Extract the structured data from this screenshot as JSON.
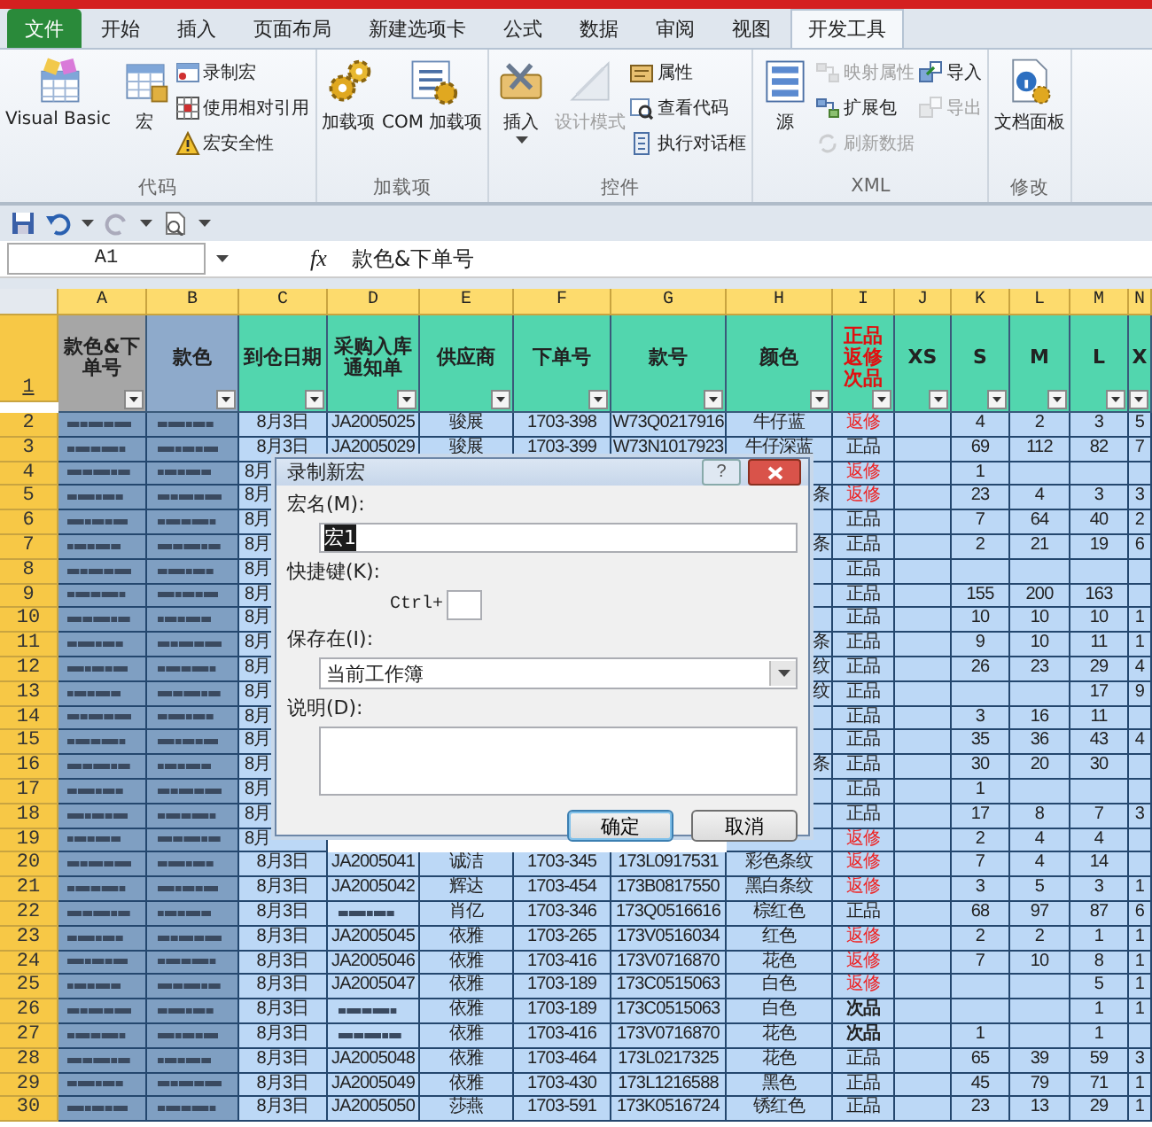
{
  "ribbon": {
    "tabs": [
      {
        "label": "文件",
        "kind": "file",
        "selected": false
      },
      {
        "label": "开始",
        "kind": "tab",
        "selected": false
      },
      {
        "label": "插入",
        "kind": "tab",
        "selected": false
      },
      {
        "label": "页面布局",
        "kind": "tab",
        "selected": false
      },
      {
        "label": "新建选项卡",
        "kind": "tab",
        "selected": false
      },
      {
        "label": "公式",
        "kind": "tab",
        "selected": false
      },
      {
        "label": "数据",
        "kind": "tab",
        "selected": false
      },
      {
        "label": "审阅",
        "kind": "tab",
        "selected": false
      },
      {
        "label": "视图",
        "kind": "tab",
        "selected": false
      },
      {
        "label": "开发工具",
        "kind": "tab",
        "selected": true
      }
    ],
    "groups": [
      {
        "title": "代码",
        "columns": [
          {
            "kind": "large",
            "label": "Visual Basic",
            "disabled": false
          },
          {
            "kind": "large",
            "label": "宏",
            "disabled": false
          },
          {
            "kind": "stack",
            "items": [
              {
                "label": "录制宏",
                "disabled": false
              },
              {
                "label": "使用相对引用",
                "disabled": false
              },
              {
                "label": "宏安全性",
                "disabled": false
              }
            ]
          }
        ]
      },
      {
        "title": "加载项",
        "columns": [
          {
            "kind": "large",
            "label": "加载项",
            "disabled": false
          },
          {
            "kind": "large",
            "label": "COM 加载项",
            "disabled": false
          }
        ]
      },
      {
        "title": "控件",
        "columns": [
          {
            "kind": "large",
            "label": "插入",
            "disabled": false,
            "dropdown": true
          },
          {
            "kind": "large",
            "label": "设计模式",
            "disabled": true
          },
          {
            "kind": "stack",
            "items": [
              {
                "label": "属性",
                "disabled": false
              },
              {
                "label": "查看代码",
                "disabled": false
              },
              {
                "label": "执行对话框",
                "disabled": false
              }
            ]
          }
        ]
      },
      {
        "title": "XML",
        "columns": [
          {
            "kind": "large",
            "label": "源",
            "disabled": false
          },
          {
            "kind": "stack",
            "items": [
              {
                "label": "映射属性",
                "disabled": true
              },
              {
                "label": "扩展包",
                "disabled": false
              },
              {
                "label": "刷新数据",
                "disabled": true
              }
            ]
          },
          {
            "kind": "stack",
            "items": [
              {
                "label": "导入",
                "disabled": false
              },
              {
                "label": "导出",
                "disabled": true
              }
            ]
          }
        ]
      },
      {
        "title": "修改",
        "columns": [
          {
            "kind": "large",
            "label": "文档面板",
            "disabled": false
          }
        ]
      }
    ]
  },
  "formula_bar": {
    "name_box": "A1",
    "function_label": "fx",
    "formula": "款色&下单号"
  },
  "sheet": {
    "column_letters": [
      "A",
      "B",
      "C",
      "D",
      "E",
      "F",
      "G",
      "H",
      "I",
      "J",
      "K",
      "L",
      "M",
      "N"
    ],
    "header_row": "1",
    "headers": [
      {
        "label": "款色&下单号",
        "color": "#a6a6a6",
        "alert": false
      },
      {
        "label": "款色",
        "color": "#8eaacb",
        "alert": false
      },
      {
        "label": "到仓日期",
        "color": "#52d6ae",
        "alert": false
      },
      {
        "label": "采购入库通知单",
        "color": "#52d6ae",
        "alert": false
      },
      {
        "label": "供应商",
        "color": "#52d6ae",
        "alert": false
      },
      {
        "label": "下单号",
        "color": "#52d6ae",
        "alert": false
      },
      {
        "label": "款号",
        "color": "#52d6ae",
        "alert": false
      },
      {
        "label": "颜色",
        "color": "#52d6ae",
        "alert": false
      },
      {
        "label": "正品返修次品",
        "color": "#52d6ae",
        "alert": true
      },
      {
        "label": "XS",
        "color": "#52d6ae",
        "alert": false
      },
      {
        "label": "S",
        "color": "#52d6ae",
        "alert": false
      },
      {
        "label": "M",
        "color": "#52d6ae",
        "alert": false
      },
      {
        "label": "L",
        "color": "#52d6ae",
        "alert": false
      },
      {
        "label": "X",
        "color": "#52d6ae",
        "alert": false
      }
    ],
    "rows": [
      {
        "num": "2",
        "c": "8月3日",
        "d": "JA2005025",
        "e": "骏展",
        "f": "1703-398",
        "g": "W73Q0217916",
        "h": "牛仔蓝",
        "i": {
          "text": "返修",
          "kind": "repair"
        },
        "k": "4",
        "l": "2",
        "m": "3",
        "n": "5"
      },
      {
        "num": "3",
        "c": "8月3日",
        "d": "JA2005029",
        "e": "骏展",
        "f": "1703-399",
        "g": "W73N1017923",
        "h": "牛仔深蓝",
        "i": {
          "text": "正品",
          "kind": "good"
        },
        "k": "69",
        "l": "112",
        "m": "82",
        "n": "7"
      },
      {
        "num": "4",
        "covered": true,
        "c": "8月",
        "i": {
          "text": "返修",
          "kind": "repair"
        },
        "k": "1"
      },
      {
        "num": "5",
        "covered": true,
        "c": "8月",
        "h": "条",
        "i": {
          "text": "返修",
          "kind": "repair"
        },
        "k": "23",
        "l": "4",
        "m": "3",
        "n": "3"
      },
      {
        "num": "6",
        "covered": true,
        "c": "8月",
        "i": {
          "text": "正品",
          "kind": "good"
        },
        "k": "7",
        "l": "64",
        "m": "40",
        "n": "2"
      },
      {
        "num": "7",
        "covered": true,
        "c": "8月",
        "h": "条",
        "i": {
          "text": "正品",
          "kind": "good"
        },
        "k": "2",
        "l": "21",
        "m": "19",
        "n": "6"
      },
      {
        "num": "8",
        "covered": true,
        "c": "8月",
        "i": {
          "text": "正品",
          "kind": "good"
        }
      },
      {
        "num": "9",
        "covered": true,
        "c": "8月",
        "i": {
          "text": "正品",
          "kind": "good"
        },
        "k": "155",
        "l": "200",
        "m": "163"
      },
      {
        "num": "10",
        "covered": true,
        "c": "8月",
        "i": {
          "text": "正品",
          "kind": "good"
        },
        "k": "10",
        "l": "10",
        "m": "10",
        "n": "1"
      },
      {
        "num": "11",
        "covered": true,
        "c": "8月",
        "h": "条",
        "i": {
          "text": "正品",
          "kind": "good"
        },
        "k": "9",
        "l": "10",
        "m": "11",
        "n": "1"
      },
      {
        "num": "12",
        "covered": true,
        "c": "8月",
        "h": "纹",
        "i": {
          "text": "正品",
          "kind": "good"
        },
        "k": "26",
        "l": "23",
        "m": "29",
        "n": "4"
      },
      {
        "num": "13",
        "covered": true,
        "c": "8月",
        "h": "纹",
        "i": {
          "text": "正品",
          "kind": "good"
        },
        "m": "17",
        "n": "9"
      },
      {
        "num": "14",
        "covered": true,
        "c": "8月",
        "i": {
          "text": "正品",
          "kind": "good"
        },
        "k": "3",
        "l": "16",
        "m": "11"
      },
      {
        "num": "15",
        "covered": true,
        "c": "8月",
        "i": {
          "text": "正品",
          "kind": "good"
        },
        "k": "35",
        "l": "36",
        "m": "43",
        "n": "4"
      },
      {
        "num": "16",
        "covered": true,
        "c": "8月",
        "h": "条",
        "i": {
          "text": "正品",
          "kind": "good"
        },
        "k": "30",
        "l": "20",
        "m": "30"
      },
      {
        "num": "17",
        "covered": true,
        "c": "8月",
        "i": {
          "text": "正品",
          "kind": "good"
        },
        "k": "1"
      },
      {
        "num": "18",
        "covered": true,
        "c": "8月",
        "i": {
          "text": "正品",
          "kind": "good"
        },
        "k": "17",
        "l": "8",
        "m": "7",
        "n": "3"
      },
      {
        "num": "19",
        "covered": true,
        "c": "8月",
        "i": {
          "text": "返修",
          "kind": "repair"
        },
        "k": "2",
        "l": "4",
        "m": "4"
      },
      {
        "num": "20",
        "c": "8月3日",
        "d": "JA2005041",
        "e": "诚洁",
        "f": "1703-345",
        "g": "173L0917531",
        "h": "彩色条纹",
        "i": {
          "text": "返修",
          "kind": "repair"
        },
        "k": "7",
        "l": "4",
        "m": "14"
      },
      {
        "num": "21",
        "c": "8月3日",
        "d": "JA2005042",
        "e": "辉达",
        "f": "1703-454",
        "g": "173B0817550",
        "h": "黑白条纹",
        "i": {
          "text": "返修",
          "kind": "repair"
        },
        "k": "3",
        "l": "5",
        "m": "3",
        "n": "1"
      },
      {
        "num": "22",
        "c": "8月3日",
        "d_blurred": true,
        "e": "肖亿",
        "f": "1703-346",
        "g": "173Q0516616",
        "h": "棕红色",
        "i": {
          "text": "正品",
          "kind": "good"
        },
        "k": "68",
        "l": "97",
        "m": "87",
        "n": "6"
      },
      {
        "num": "23",
        "c": "8月3日",
        "d": "JA2005045",
        "e": "依雅",
        "f": "1703-265",
        "g": "173V0516034",
        "h": "红色",
        "i": {
          "text": "返修",
          "kind": "repair"
        },
        "k": "2",
        "l": "2",
        "m": "1",
        "n": "1"
      },
      {
        "num": "24",
        "c": "8月3日",
        "d": "JA2005046",
        "e": "依雅",
        "f": "1703-416",
        "g": "173V0716870",
        "h": "花色",
        "i": {
          "text": "返修",
          "kind": "repair"
        },
        "k": "7",
        "l": "10",
        "m": "8",
        "n": "1"
      },
      {
        "num": "25",
        "c": "8月3日",
        "d": "JA2005047",
        "e": "依雅",
        "f": "1703-189",
        "g": "173C0515063",
        "h": "白色",
        "i": {
          "text": "返修",
          "kind": "repair"
        },
        "m": "5",
        "n": "1"
      },
      {
        "num": "26",
        "c": "8月3日",
        "d_blurred": true,
        "e": "依雅",
        "f": "1703-189",
        "g": "173C0515063",
        "h": "白色",
        "i": {
          "text": "次品",
          "kind": "defect"
        },
        "m": "1",
        "n": "1"
      },
      {
        "num": "27",
        "c": "8月3日",
        "d_blurred": true,
        "e": "依雅",
        "f": "1703-416",
        "g": "173V0716870",
        "h": "花色",
        "i": {
          "text": "次品",
          "kind": "defect"
        },
        "k": "1",
        "m": "1"
      },
      {
        "num": "28",
        "c": "8月3日",
        "d": "JA2005048",
        "e": "依雅",
        "f": "1703-464",
        "g": "173L0217325",
        "h": "花色",
        "i": {
          "text": "正品",
          "kind": "good"
        },
        "k": "65",
        "l": "39",
        "m": "59",
        "n": "3"
      },
      {
        "num": "29",
        "c": "8月3日",
        "d": "JA2005049",
        "e": "依雅",
        "f": "1703-430",
        "g": "173L1216588",
        "h": "黑色",
        "i": {
          "text": "正品",
          "kind": "good"
        },
        "k": "45",
        "l": "79",
        "m": "71",
        "n": "1"
      },
      {
        "num": "30",
        "c": "8月3日",
        "d": "JA2005050",
        "e": "莎燕",
        "f": "1703-591",
        "g": "173K0516724",
        "h": "锈红色",
        "i": {
          "text": "正品",
          "kind": "good"
        },
        "k": "23",
        "l": "13",
        "m": "29",
        "n": "1"
      }
    ]
  },
  "dialog": {
    "title": "录制新宏",
    "help": "?",
    "name_label": "宏名(M):",
    "name_value": "宏1",
    "shortcut_label": "快捷键(K):",
    "ctrl_label": "Ctrl+",
    "store_label": "保存在(I):",
    "store_value": "当前工作簿",
    "desc_label": "说明(D):",
    "ok": "确定",
    "cancel": "取消"
  }
}
